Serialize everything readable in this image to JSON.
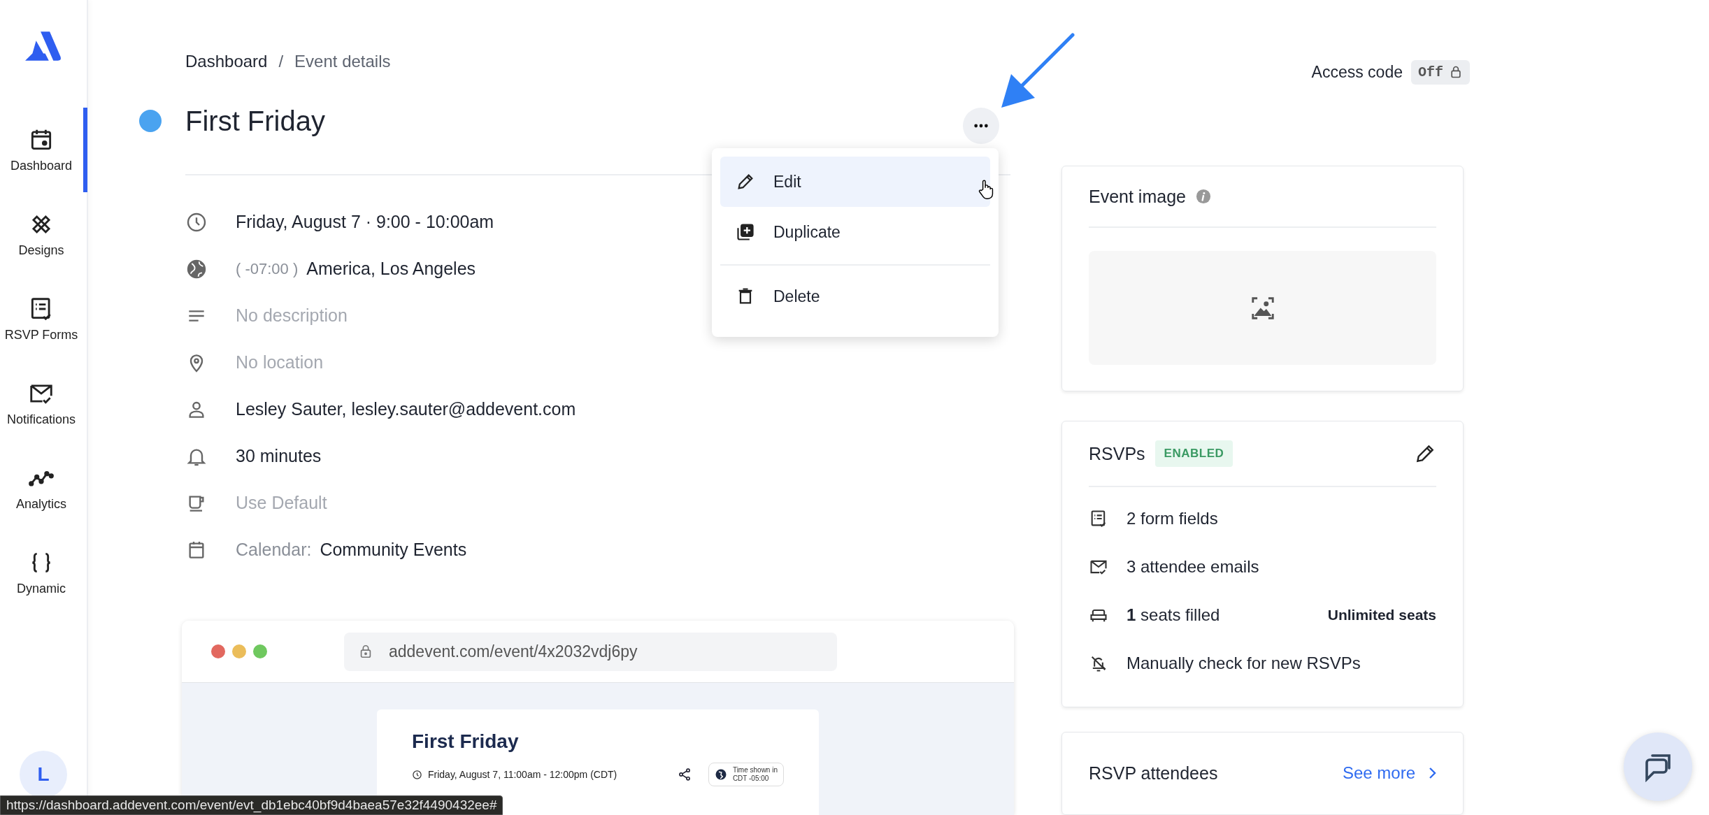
{
  "sidebar": {
    "items": [
      {
        "label": "Dashboard",
        "selected": true
      },
      {
        "label": "Designs",
        "selected": false
      },
      {
        "label": "RSVP Forms",
        "selected": false
      },
      {
        "label": "Notifications",
        "selected": false
      },
      {
        "label": "Analytics",
        "selected": false
      },
      {
        "label": "Dynamic",
        "selected": false
      }
    ],
    "avatar": "L"
  },
  "breadcrumb": {
    "items": [
      "Dashboard",
      "Event details"
    ],
    "separator": "/"
  },
  "event": {
    "title": "First Friday",
    "color": "#4aa3f0"
  },
  "menu": {
    "items": [
      {
        "label": "Edit",
        "kind": "edit",
        "selected": true,
        "divider_before": false
      },
      {
        "label": "Duplicate",
        "kind": "duplicate",
        "selected": false,
        "divider_before": false
      },
      {
        "label": "Delete",
        "kind": "delete",
        "selected": false,
        "divider_before": true
      }
    ]
  },
  "access_code": {
    "label": "Access code",
    "value": "Off"
  },
  "details": [
    {
      "kind": "time",
      "text": "Friday, August 7 · 9:00 - 10:00am",
      "muted": false
    },
    {
      "kind": "timezone",
      "prefix": "( -07:00 )",
      "text": "America, Los Angeles",
      "muted": false
    },
    {
      "kind": "description",
      "text": "No description",
      "muted": true
    },
    {
      "kind": "location",
      "text": "No location",
      "muted": true
    },
    {
      "kind": "organizer",
      "text": "Lesley Sauter, lesley.sauter@addevent.com",
      "muted": false
    },
    {
      "kind": "reminder",
      "text": "30 minutes",
      "muted": false
    },
    {
      "kind": "status",
      "text": "Use Default",
      "muted": true
    },
    {
      "kind": "calendar",
      "prefix": "Calendar:",
      "text": "Community Events",
      "muted": false
    }
  ],
  "event_image": {
    "title": "Event image"
  },
  "rsvps": {
    "title": "RSVPs",
    "badge": "ENABLED",
    "rows": [
      {
        "kind": "form",
        "text": "2 form fields"
      },
      {
        "kind": "emails",
        "text": "3 attendee emails"
      },
      {
        "kind": "seats",
        "text": "**1** seats filled",
        "aside": "Unlimited seats"
      },
      {
        "kind": "notify",
        "text": "Manually check for new RSVPs"
      }
    ]
  },
  "attendees": {
    "title": "RSVP attendees",
    "link": "See more"
  },
  "preview": {
    "url": "addevent.com/event/4x2032vdj6py",
    "title": "First Friday",
    "date": "Friday, August 7, 11:00am - 12:00pm (CDT)",
    "timezone": [
      "Time shown in",
      "CDT -05:00"
    ]
  },
  "status_bar": "https://dashboard.addevent.com/event/evt_db1ebc40bf9d4baea57e32f4490432ee#"
}
